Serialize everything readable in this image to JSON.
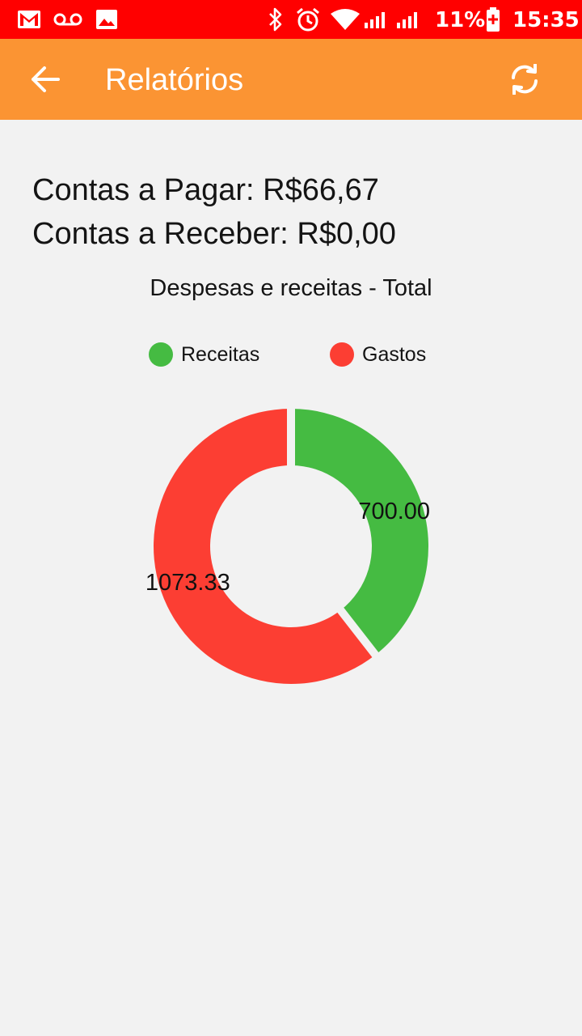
{
  "status_bar": {
    "battery_percent": "11%",
    "time": "15:35",
    "left_icons": [
      "gmail-icon",
      "voicemail-icon",
      "gallery-icon"
    ],
    "right_icons": [
      "bluetooth-icon",
      "alarm-icon",
      "wifi-icon",
      "signal-icon",
      "signal-icon",
      "battery-charging-icon"
    ],
    "color": "#ff0000"
  },
  "app_bar": {
    "title": "Relatórios",
    "back_icon": "arrow-back-icon",
    "refresh_icon": "refresh-icon",
    "color": "#fb9433"
  },
  "summary": {
    "contas_pagar": "Contas a Pagar: R$66,67",
    "contas_receber": "Contas a Receber: R$0,00"
  },
  "chart_data": {
    "type": "pie",
    "style": "donut",
    "title": "Despesas e receitas - Total",
    "legend_position": "top",
    "categories": [
      "Receitas",
      "Gastos"
    ],
    "values": [
      700.0,
      1073.33
    ],
    "labels": [
      "700.00",
      "1073.33"
    ],
    "colors": [
      "#45bb42",
      "#fc3e33"
    ]
  }
}
